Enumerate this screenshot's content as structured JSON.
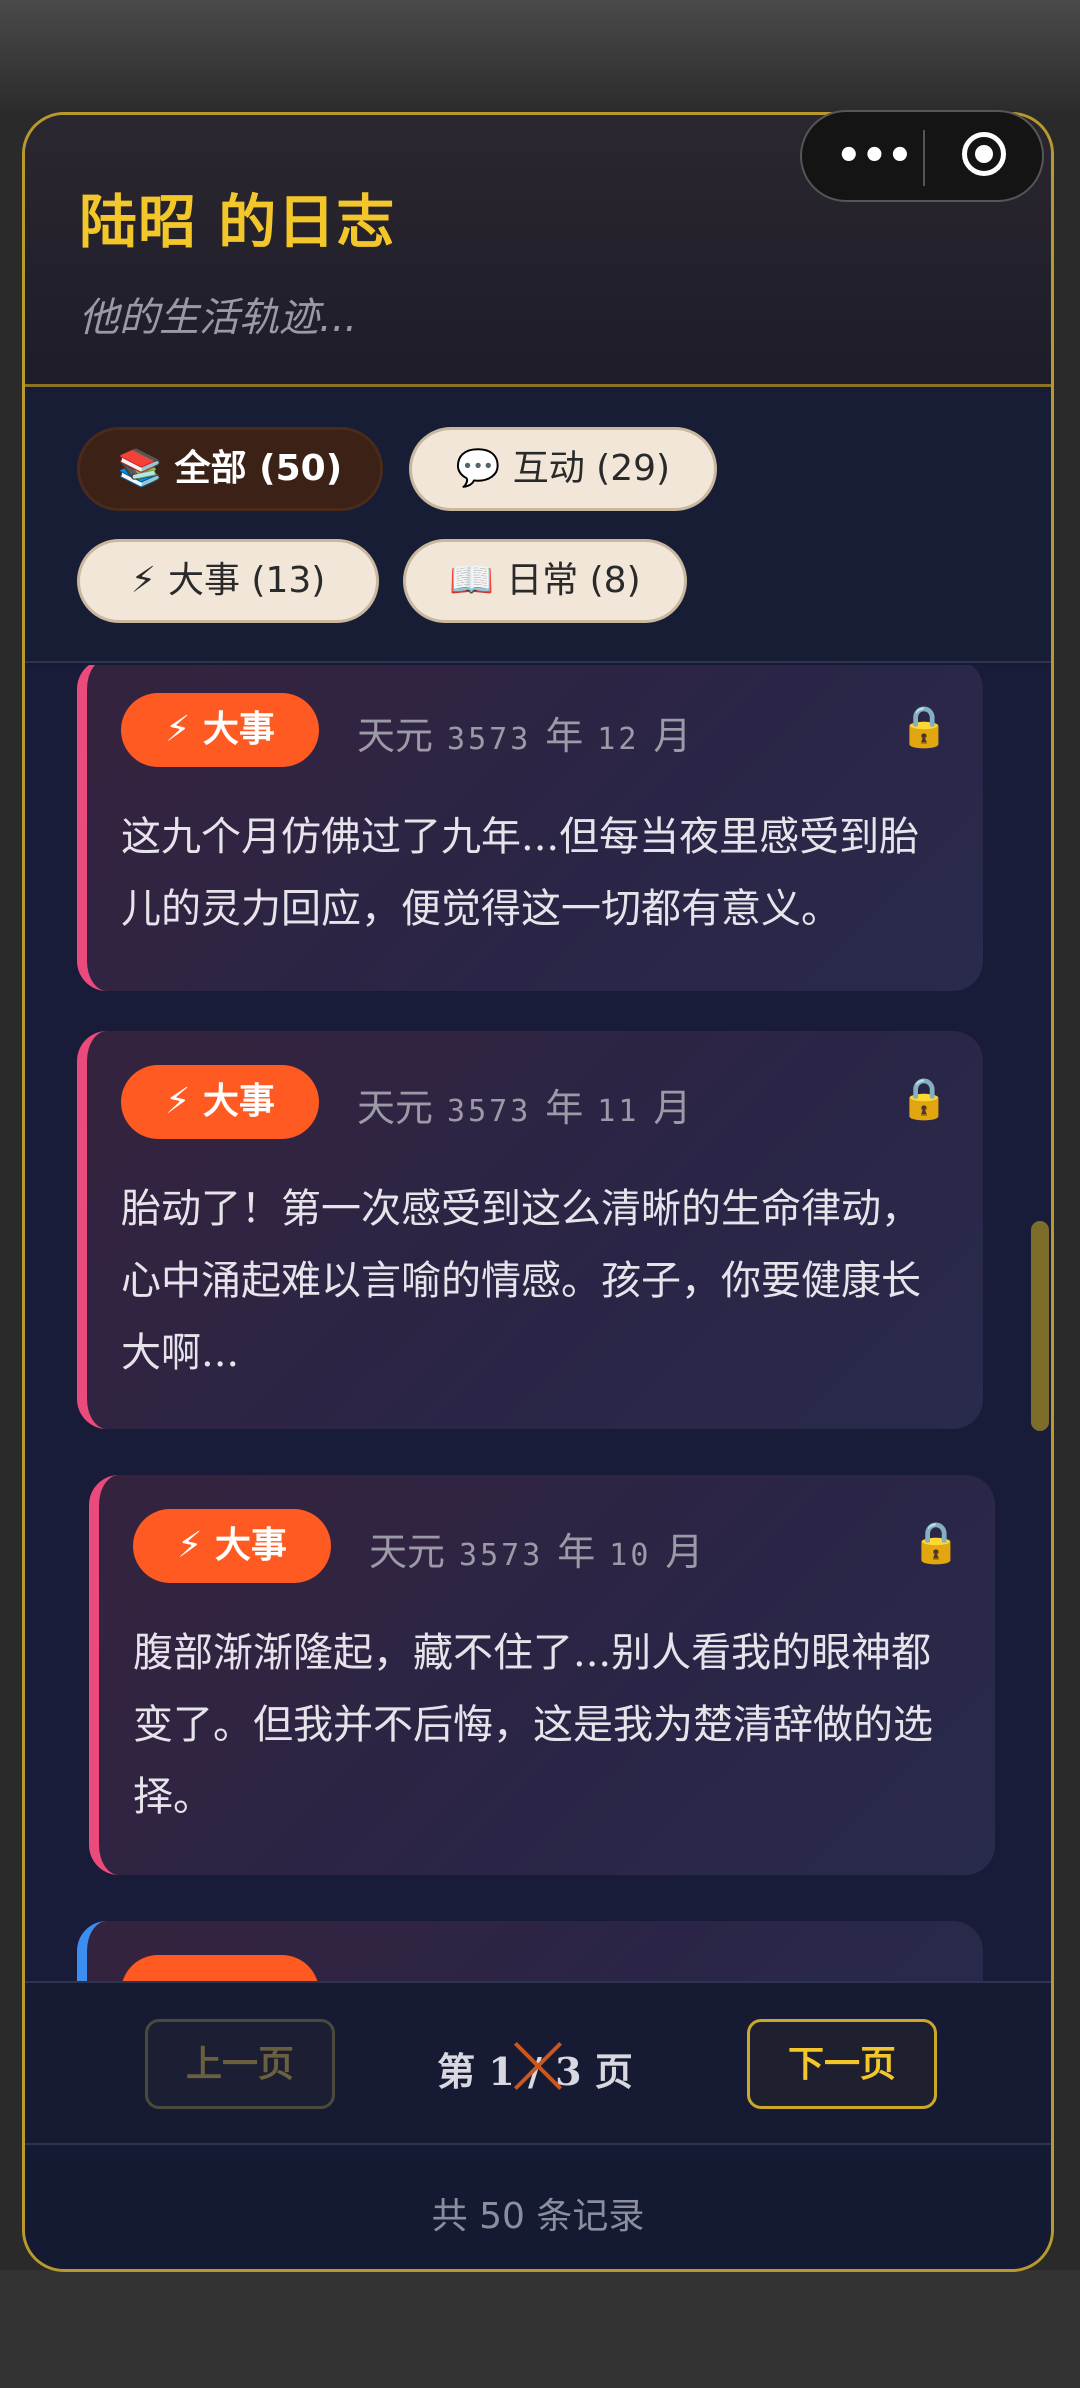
{
  "header": {
    "title": "陆昭 的日志",
    "subtitle": "他的生活轨迹..."
  },
  "capsule": {
    "more_icon": "more-dots-icon",
    "close_icon": "target-circle-icon"
  },
  "filters": [
    {
      "icon": "📚",
      "label": "全部 (50)",
      "active": true
    },
    {
      "icon": "💬",
      "label": "互动 (29)",
      "active": false
    },
    {
      "icon": "⚡",
      "label": "大事 (13)",
      "active": false
    },
    {
      "icon": "📖",
      "label": "日常 (8)",
      "active": false
    }
  ],
  "entries": [
    {
      "badge": "⚡ 大事",
      "era": "天元",
      "year": "3573",
      "year_unit": "年",
      "month": "12",
      "month_unit": "月",
      "lock": "🔒",
      "text": "这九个月仿佛过了九年...但每当夜里感受到胎儿的灵力回应，便觉得这一切都有意义。"
    },
    {
      "badge": "⚡ 大事",
      "era": "天元",
      "year": "3573",
      "year_unit": "年",
      "month": "11",
      "month_unit": "月",
      "lock": "🔒",
      "text": "胎动了！第一次感受到这么清晰的生命律动，心中涌起难以言喻的情感。孩子，你要健康长大啊..."
    },
    {
      "badge": "⚡ 大事",
      "era": "天元",
      "year": "3573",
      "year_unit": "年",
      "month": "10",
      "month_unit": "月",
      "lock": "🔒",
      "text": "腹部渐渐隆起，藏不住了...别人看我的眼神都变了。但我并不后悔，这是我为楚清辞做的选择。"
    }
  ],
  "pagination": {
    "prev_label": "上一页",
    "page_info": "第 1 / 3 页",
    "next_label": "下一页",
    "total": "共 50 条记录"
  },
  "colors": {
    "accent": "#f3c62a",
    "badge": "#ff5a22",
    "card_border": "#ea4a7c",
    "card_border_alt": "#3c8ef0"
  }
}
